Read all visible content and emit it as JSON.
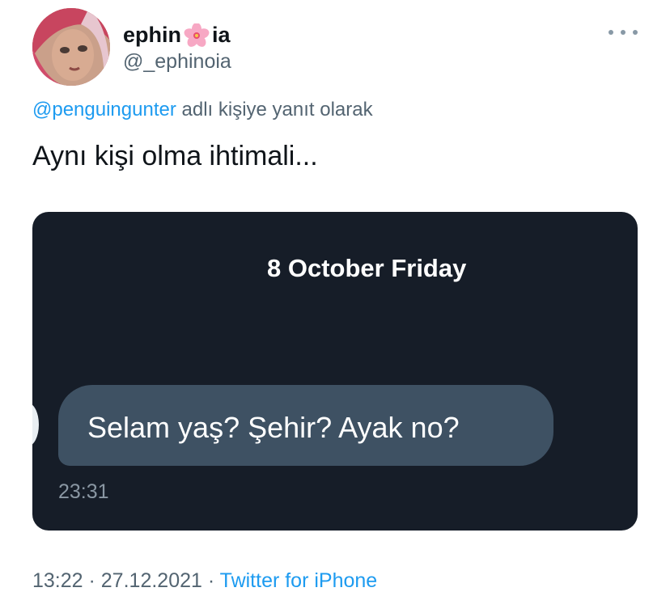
{
  "tweet": {
    "display_name_prefix": "ephin",
    "display_name_suffix": "ia",
    "name_emoji": "cherry-blossom-icon",
    "handle": "@_ephinoia",
    "reply_to_user": "@penguingunter",
    "reply_suffix": " adlı kişiye yanıt olarak",
    "text": "Aynı kişi olma ihtimali...",
    "time": "13:22",
    "separator1": " · ",
    "date": "27.12.2021",
    "separator2": " · ",
    "source": "Twitter for iPhone"
  },
  "media": {
    "chat_date": "8 October Friday",
    "message_text": "Selam yaş? Şehir? Ayak no?",
    "message_time": "23:31"
  },
  "colors": {
    "accent": "#1d9bf0",
    "secondary_text": "#536471",
    "chat_background": "#161d28",
    "bubble": "#3e5163"
  }
}
